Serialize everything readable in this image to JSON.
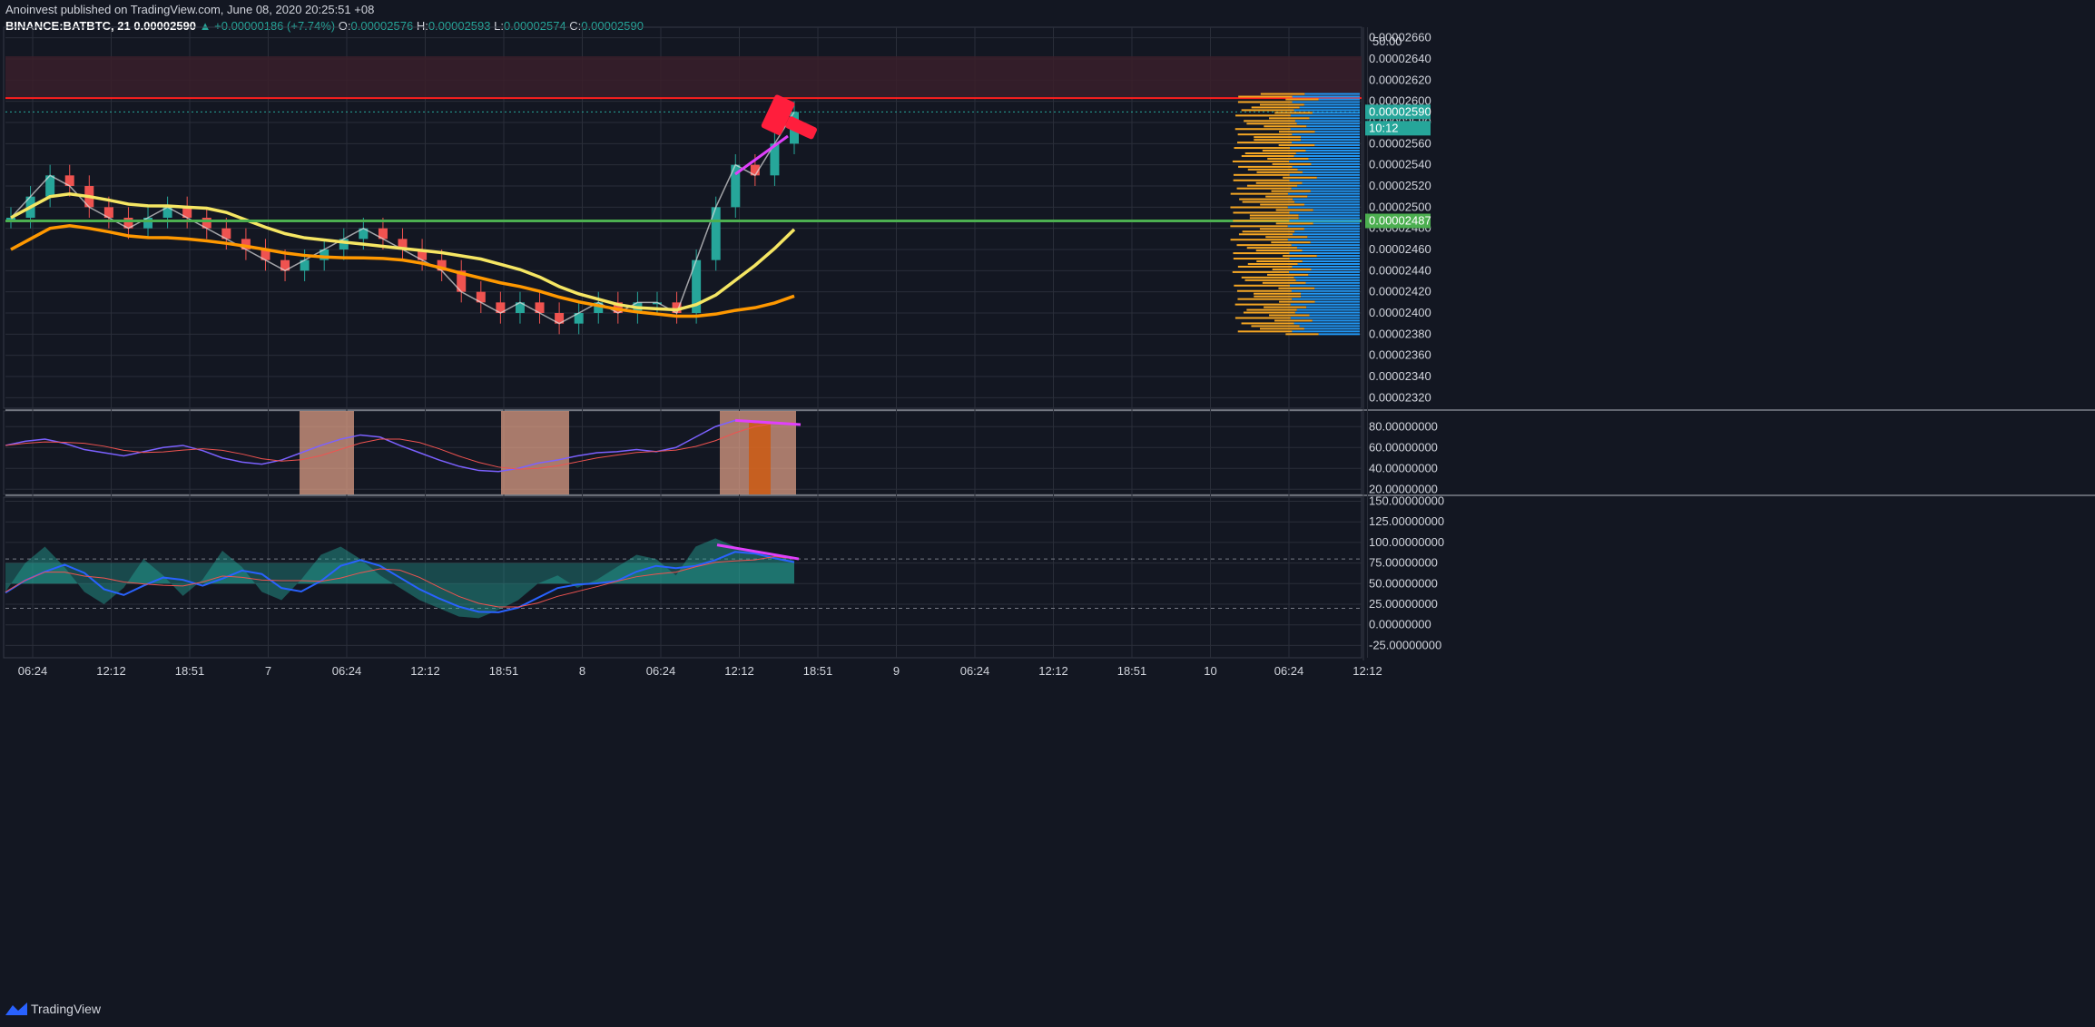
{
  "header": {
    "line1": "Anoinvest published on TradingView.com, June 08, 2020 20:25:51 +08",
    "symbol": "BINANCE:BATBTC, 21",
    "last": "0.00002590",
    "change": "▲ +0.00000186 (+7.74%)",
    "o_label": "O:",
    "o": "0.00002576",
    "h_label": "H:",
    "h": "0.00002593",
    "l_label": "L:",
    "l": "0.00002574",
    "c_label": "C:",
    "c": "0.00002590"
  },
  "footer": {
    "brand": "TradingView"
  },
  "colors": {
    "background": "#131722",
    "up": "#26a69a",
    "down": "#ef5350",
    "resistance": "#ff1e1e",
    "support": "#4caf50",
    "annotation": "#e040fb",
    "volume_profile_up": "#2196f3",
    "volume_profile_down": "#f5a623"
  },
  "chart_data": [
    {
      "type": "line",
      "panel": "price",
      "note_ranges": "candlestick price chart",
      "x_ticks": [
        "06:24",
        "12:12",
        "18:51",
        "7",
        "06:24",
        "12:12",
        "18:51",
        "8",
        "06:24",
        "12:12",
        "18:51",
        "9",
        "06:24",
        "12:12",
        "18:51",
        "10",
        "06:24",
        "12:12"
      ],
      "y_ticks": [
        "0.00002660",
        "0.00002640",
        "0.00002620",
        "0.00002600",
        "0.00002580",
        "0.00002560",
        "0.00002540",
        "0.00002520",
        "0.00002500",
        "0.00002480",
        "0.00002460",
        "0.00002440",
        "0.00002420",
        "0.00002400",
        "0.00002380",
        "0.00002360",
        "0.00002340",
        "0.00002320"
      ],
      "ylim": [
        2.31e-05,
        2.67e-05
      ],
      "last_price_label": "0.00002590",
      "countdown_label": "10:12",
      "support_label": "0.00002487",
      "resistance_level": 2.603e-05,
      "support_level": 2.487e-05,
      "close_series": [
        2.49e-05,
        2.51e-05,
        2.53e-05,
        2.52e-05,
        2.5e-05,
        2.49e-05,
        2.48e-05,
        2.49e-05,
        2.5e-05,
        2.49e-05,
        2.48e-05,
        2.47e-05,
        2.46e-05,
        2.45e-05,
        2.44e-05,
        2.45e-05,
        2.46e-05,
        2.47e-05,
        2.48e-05,
        2.47e-05,
        2.46e-05,
        2.45e-05,
        2.44e-05,
        2.42e-05,
        2.41e-05,
        2.4e-05,
        2.41e-05,
        2.4e-05,
        2.39e-05,
        2.4e-05,
        2.41e-05,
        2.4e-05,
        2.41e-05,
        2.41e-05,
        2.4e-05,
        2.45e-05,
        2.5e-05,
        2.54e-05,
        2.53e-05,
        2.56e-05,
        2.59e-05
      ]
    },
    {
      "type": "line",
      "panel": "rsi",
      "y_ticks": [
        "80.00000000",
        "60.00000000",
        "40.00000000",
        "20.00000000"
      ],
      "ylim": [
        15,
        95
      ],
      "values": [
        62,
        66,
        68,
        64,
        58,
        55,
        52,
        56,
        60,
        62,
        57,
        50,
        46,
        44,
        48,
        55,
        62,
        68,
        72,
        70,
        62,
        55,
        48,
        42,
        38,
        37,
        40,
        45,
        48,
        52,
        55,
        56,
        58,
        56,
        60,
        70,
        80,
        86,
        84,
        83,
        82
      ]
    },
    {
      "type": "area",
      "panel": "oscillator",
      "y_ticks": [
        "150.00000000",
        "125.00000000",
        "100.00000000",
        "75.00000000",
        "50.00000000",
        "25.00000000",
        "0.00000000",
        "-25.00000000"
      ],
      "ylim": [
        -40,
        155
      ],
      "values": [
        40,
        75,
        95,
        70,
        40,
        25,
        45,
        80,
        60,
        35,
        55,
        90,
        70,
        40,
        30,
        55,
        85,
        95,
        80,
        60,
        45,
        30,
        20,
        10,
        8,
        18,
        30,
        50,
        60,
        45,
        55,
        70,
        85,
        80,
        60,
        95,
        105,
        95,
        88,
        85,
        78
      ]
    }
  ]
}
